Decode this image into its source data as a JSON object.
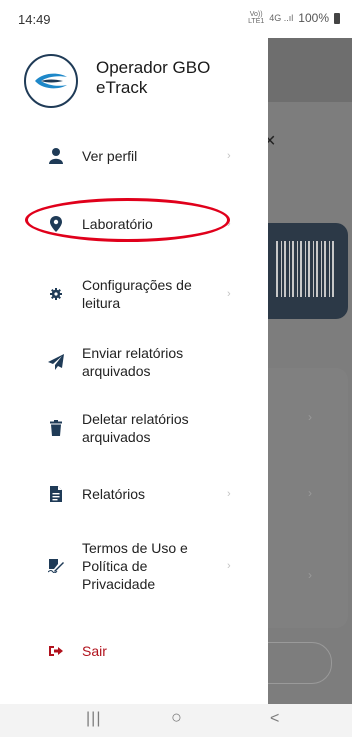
{
  "status_bar": {
    "time": "14:49",
    "volte": "Vo))\nLTE1",
    "signal": "4G",
    "battery": "100%"
  },
  "drawer": {
    "user_name": "Operador GBO eTrack",
    "items": [
      {
        "label": "Ver perfil",
        "icon": "person-icon"
      },
      {
        "label": "Laboratório",
        "icon": "location-pin-icon"
      },
      {
        "label": "Configurações de leitura",
        "icon": "gear-icon"
      },
      {
        "label": "Enviar relatórios arquivados",
        "icon": "send-icon"
      },
      {
        "label": "Deletar relatórios arquivados",
        "icon": "trash-icon"
      },
      {
        "label": "Relatórios",
        "icon": "document-icon"
      },
      {
        "label": "Termos de Uso e Política de Privacidade",
        "icon": "signature-icon"
      },
      {
        "label": "Sair",
        "icon": "logout-icon"
      }
    ],
    "chevron": "›"
  },
  "background_app": {
    "close_glyph": "×"
  },
  "nav_bar": {
    "recents": "|||",
    "home": "○",
    "back": "<"
  },
  "colors": {
    "drawer_bg": "#ffffff",
    "scrim": "#7d7d7d",
    "logout": "#b1121d",
    "icon": "#1f3b57",
    "highlight": "#e0001b"
  }
}
